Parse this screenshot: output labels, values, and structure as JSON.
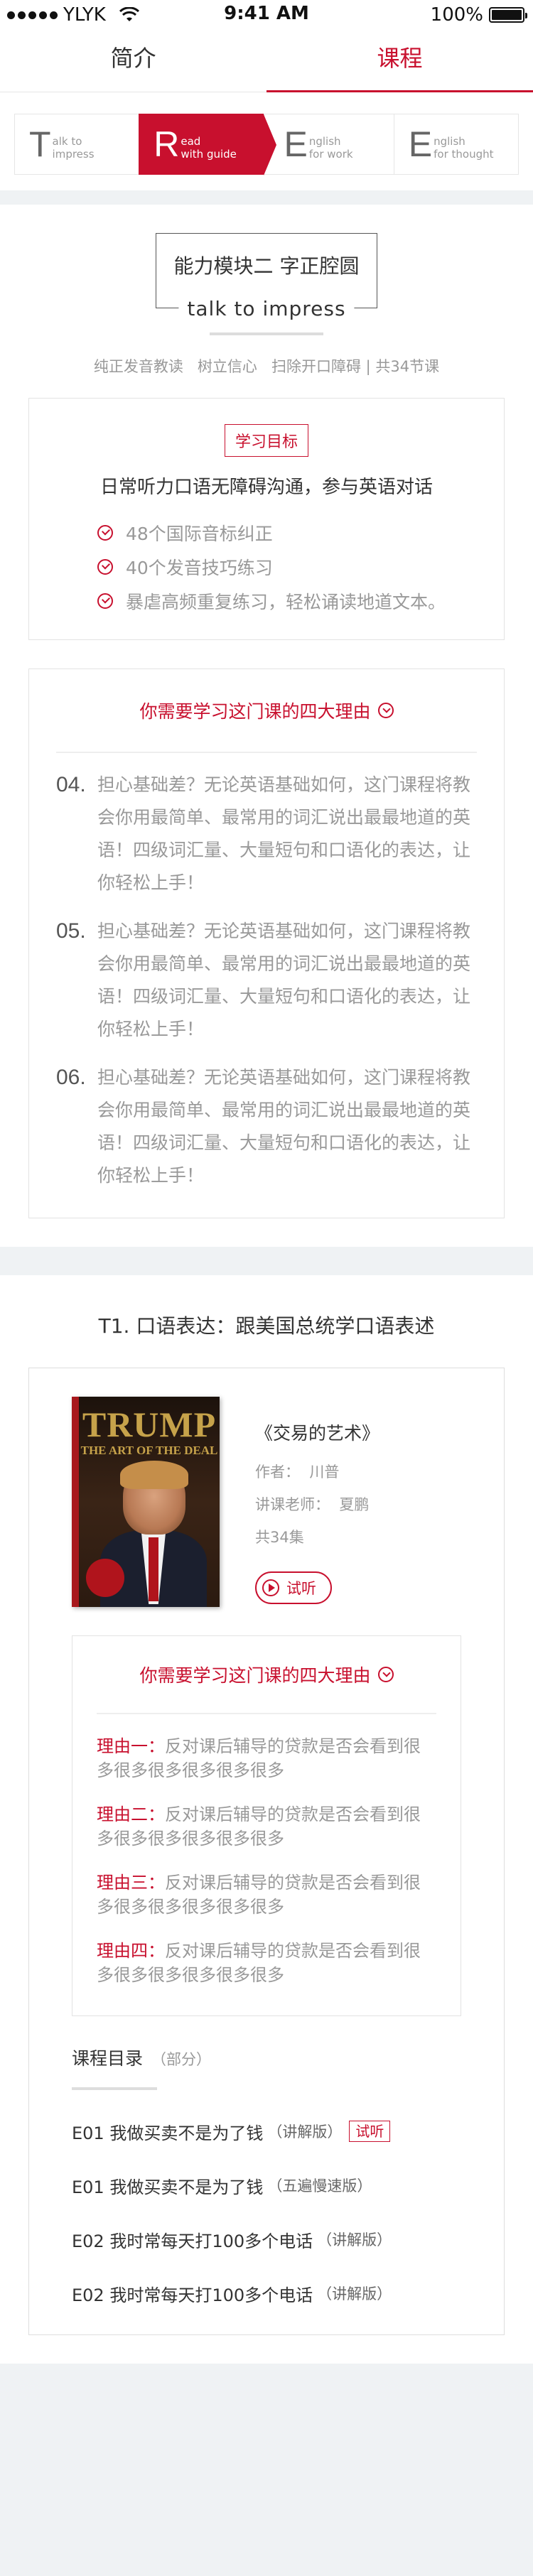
{
  "status_bar": {
    "carrier": "YLYK",
    "time": "9:41 AM",
    "battery": "100%",
    "battery_level": 1.0
  },
  "tabs": [
    {
      "label": "简介"
    },
    {
      "label": "课程"
    }
  ],
  "modules": [
    {
      "letter": "T",
      "line1": "alk to",
      "line2": "impress"
    },
    {
      "letter": "R",
      "line1": "ead",
      "line2": "with guide"
    },
    {
      "letter": "E",
      "line1": "nglish",
      "line2": "for work"
    },
    {
      "letter": "E",
      "line1": "nglish",
      "line2": "for thought"
    }
  ],
  "module_title": {
    "cn": "能力模块二 字正腔圆",
    "en": "talk to impress",
    "subtitle": "纯正发音教读   树立信心   扫除开口障碍 | 共34节课"
  },
  "goal": {
    "badge": "学习目标",
    "title": "日常听力口语无障碍沟通，参与英语对话",
    "items": [
      "48个国际音标纠正",
      "40个发音技巧练习",
      "暴虐高频重复练习，轻松诵读地道文本。"
    ]
  },
  "reasons1": {
    "heading": "你需要学习这门课的四大理由",
    "items": [
      {
        "num": "04.",
        "text": "担心基础差？无论英语基础如何，这门课程将教会你用最简单、最常用的词汇说出最最地道的英语！四级词汇量、大量短句和口语化的表达，让你轻松上手！"
      },
      {
        "num": "05.",
        "text": "担心基础差？无论英语基础如何，这门课程将教会你用最简单、最常用的词汇说出最最地道的英语！四级词汇量、大量短句和口语化的表达，让你轻松上手！"
      },
      {
        "num": "06.",
        "text": "担心基础差？无论英语基础如何，这门课程将教会你用最简单、最常用的词汇说出最最地道的英语！四级词汇量、大量短句和口语化的表达，让你轻松上手！"
      }
    ]
  },
  "lesson": {
    "title": "T1. 口语表达：跟美国总统学口语表述",
    "book": {
      "cover_title": "TRUMP",
      "cover_subtitle": "THE ART OF THE DEAL",
      "name": "《交易的艺术》",
      "author": "作者：  川普",
      "teacher": "讲课老师：  夏鹏",
      "count": "共34集",
      "listen": "试听"
    },
    "reasons": {
      "heading": "你需要学习这门课的四大理由",
      "items": [
        {
          "label": "理由一：",
          "text": "反对课后辅导的贷款是否会看到很多很多很多很多很多很多"
        },
        {
          "label": "理由二：",
          "text": "反对课后辅导的贷款是否会看到很多很多很多很多很多很多"
        },
        {
          "label": "理由三：",
          "text": "反对课后辅导的贷款是否会看到很多很多很多很多很多很多"
        },
        {
          "label": "理由四：",
          "text": "反对课后辅导的贷款是否会看到很多很多很多很多很多很多"
        }
      ]
    },
    "catalog": {
      "heading": "课程目录",
      "part": "（部分）",
      "episodes": [
        {
          "title": "E01 我做买卖不是为了钱",
          "note": "（讲解版）",
          "tag": "试听"
        },
        {
          "title": "E01 我做买卖不是为了钱",
          "note": "（五遍慢速版）",
          "tag": ""
        },
        {
          "title": "E02 我时常每天打100多个电话",
          "note": "（讲解版）",
          "tag": ""
        },
        {
          "title": "E02 我时常每天打100多个电话",
          "note": "（讲解版）",
          "tag": ""
        }
      ]
    }
  }
}
